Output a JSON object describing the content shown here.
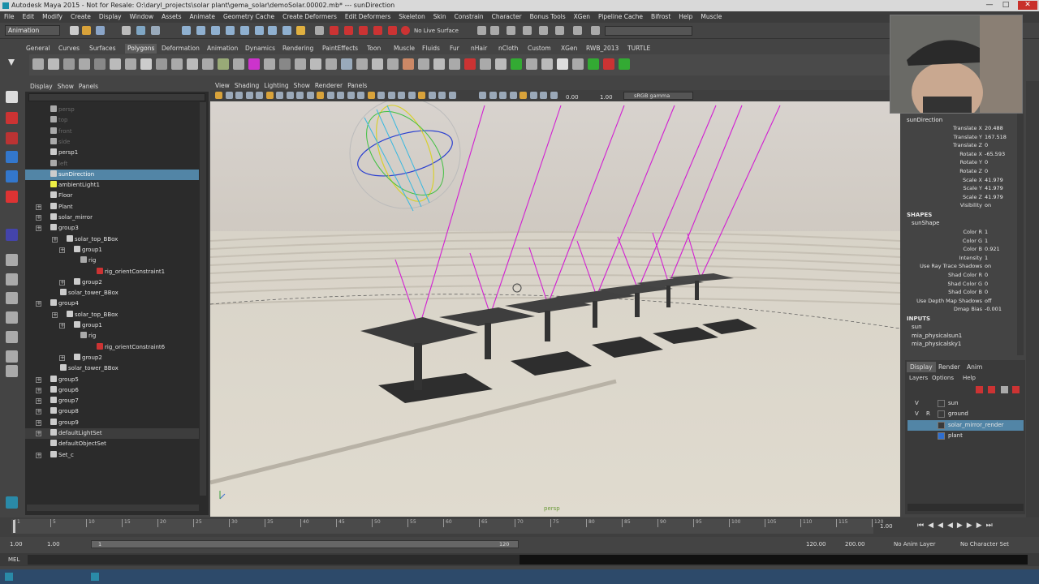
{
  "window": {
    "title": "Autodesk Maya 2015 - Not for Resale: O:\\daryl_projects\\solar plant\\gema_solar\\demoSolar.00002.mb* --- sunDirection",
    "minimize": "—",
    "maximize": "□",
    "close": "✕"
  },
  "menubar": [
    "File",
    "Edit",
    "Modify",
    "Create",
    "Display",
    "Window",
    "Assets",
    "Animate",
    "Geometry Cache",
    "Create Deformers",
    "Edit Deformers",
    "Skeleton",
    "Skin",
    "Constrain",
    "Character",
    "Bonus Tools",
    "XGen",
    "Pipeline Cache",
    "Bifrost",
    "Help",
    "Muscle"
  ],
  "statusline": {
    "mode": "Animation",
    "live_surface": "No Live Surface"
  },
  "shelf_tabs": [
    "General",
    "Curves",
    "Surfaces",
    "Polygons",
    "Deformation",
    "Animation",
    "Dynamics",
    "Rendering",
    "PaintEffects",
    "Toon",
    "Muscle",
    "Fluids",
    "Fur",
    "nHair",
    "nCloth",
    "Custom",
    "XGen",
    "RWB_2013",
    "TURTLE"
  ],
  "shelf_active": "Polygons",
  "outliner": {
    "menu": [
      "Display",
      "Show",
      "Panels"
    ],
    "items": [
      {
        "label": "persp",
        "dim": true
      },
      {
        "label": "top",
        "dim": true
      },
      {
        "label": "front",
        "dim": true
      },
      {
        "label": "side",
        "dim": true
      },
      {
        "label": "persp1",
        "dim": false
      },
      {
        "label": "left",
        "dim": true
      },
      {
        "label": "sunDirection",
        "selected": true
      },
      {
        "label": "ambientLight1"
      },
      {
        "label": "Floor"
      },
      {
        "label": "Plant"
      },
      {
        "label": "solar_mirror"
      },
      {
        "label": "group3"
      },
      {
        "label": "solar_top_BBox"
      },
      {
        "label": "group1"
      },
      {
        "label": "rig"
      },
      {
        "label": "rig_orientConstraint1"
      },
      {
        "label": "group2"
      },
      {
        "label": "solar_tower_BBox"
      },
      {
        "label": "group4"
      },
      {
        "label": "solar_top_BBox"
      },
      {
        "label": "group1"
      },
      {
        "label": "rig"
      },
      {
        "label": "rig_orientConstraint6"
      },
      {
        "label": "group2"
      },
      {
        "label": "solar_tower_BBox"
      },
      {
        "label": "group5"
      },
      {
        "label": "group6"
      },
      {
        "label": "group7"
      },
      {
        "label": "group8"
      },
      {
        "label": "group9"
      },
      {
        "label": "defaultLightSet"
      },
      {
        "label": "defaultObjectSet"
      },
      {
        "label": "Set_c"
      }
    ]
  },
  "viewport": {
    "menu": [
      "View",
      "Shading",
      "Lighting",
      "Show",
      "Renderer",
      "Panels"
    ],
    "field_a": "0.00",
    "field_b": "1.00",
    "gamma": "sRGB gamma",
    "camera": "persp"
  },
  "channel_box": {
    "object": "sunDirection",
    "transform": [
      {
        "label": "Translate X",
        "value": "20.488"
      },
      {
        "label": "Translate Y",
        "value": "167.518"
      },
      {
        "label": "Translate Z",
        "value": "0"
      },
      {
        "label": "Rotate X",
        "value": "-65.593"
      },
      {
        "label": "Rotate Y",
        "value": "0"
      },
      {
        "label": "Rotate Z",
        "value": "0"
      },
      {
        "label": "Scale X",
        "value": "41.979"
      },
      {
        "label": "Scale Y",
        "value": "41.979"
      },
      {
        "label": "Scale Z",
        "value": "41.979"
      },
      {
        "label": "Visibility",
        "value": "on"
      }
    ],
    "shapes_header": "SHAPES",
    "shape_name": "sunShape",
    "shape_attrs": [
      {
        "label": "Color R",
        "value": "1"
      },
      {
        "label": "Color G",
        "value": "1"
      },
      {
        "label": "Color B",
        "value": "0.921"
      },
      {
        "label": "Intensity",
        "value": "1"
      },
      {
        "label": "Use Ray Trace Shadows",
        "value": "on"
      },
      {
        "label": "Shad Color R",
        "value": "0"
      },
      {
        "label": "Shad Color G",
        "value": "0"
      },
      {
        "label": "Shad Color B",
        "value": "0"
      },
      {
        "label": "Use Depth Map Shadows",
        "value": "off"
      },
      {
        "label": "Dmap Bias",
        "value": "-0.001"
      }
    ],
    "inputs_header": "INPUTS",
    "inputs": [
      "sun",
      "mia_physicalsun1",
      "mia_physicalsky1"
    ]
  },
  "layer_editor": {
    "tabs": [
      "Display",
      "Render",
      "Anim"
    ],
    "active_tab": "Display",
    "menu": [
      "Layers",
      "Options",
      "Help"
    ],
    "layers": [
      {
        "v": "V",
        "r": "",
        "name": "sun",
        "color": "#3a3a3a",
        "selected": false
      },
      {
        "v": "V",
        "r": "R",
        "name": "ground",
        "color": "#3a3a3a",
        "selected": false
      },
      {
        "v": "",
        "r": "",
        "name": "solar_mirror_render",
        "color": "#3a3a3a",
        "selected": true
      },
      {
        "v": "",
        "r": "",
        "name": "plant",
        "color": "#2f6fd0",
        "selected": false
      }
    ]
  },
  "timeline": {
    "ticks": [
      "1",
      "5",
      "10",
      "15",
      "20",
      "25",
      "30",
      "35",
      "40",
      "45",
      "50",
      "55",
      "60",
      "65",
      "70",
      "75",
      "80",
      "85",
      "90",
      "95",
      "100",
      "105",
      "110",
      "115",
      "120"
    ],
    "current_frame": "1.00"
  },
  "range": {
    "start": "1.00",
    "inner_start": "1.00",
    "inner_start_label": "1",
    "inner_end_label": "120",
    "end": "120.00",
    "total_end": "200.00",
    "anim_layer": "No Anim Layer",
    "char_set": "No Character Set"
  },
  "cmdline": {
    "label": "MEL"
  },
  "colors": {
    "selection": "#5285a6",
    "light_lines": "#d21ed2",
    "ground": "#d6d1c6",
    "sky": "#d4d0cb"
  },
  "icons": [
    "select-icon",
    "lasso-icon",
    "paint-icon",
    "move-icon",
    "rotate-icon",
    "scale-icon"
  ]
}
